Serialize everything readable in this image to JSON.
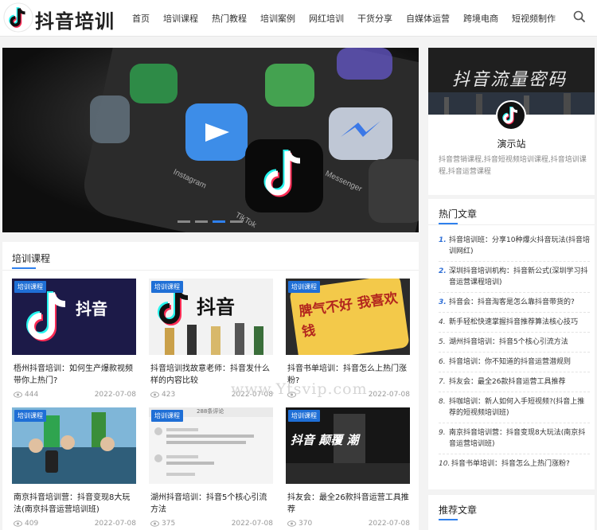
{
  "header": {
    "logo_text": "抖音培训",
    "nav": [
      "首页",
      "培训课程",
      "热门教程",
      "培训案例",
      "网红培训",
      "干货分享",
      "自媒体运营",
      "跨境电商",
      "短视频制作"
    ]
  },
  "slider": {
    "app_labels": [
      "Instagram",
      "Messenger",
      "TikTok"
    ],
    "active_dot": 3,
    "dot_count": 4
  },
  "courses": {
    "title": "培训课程",
    "items": [
      {
        "tag": "培训课程",
        "title": "梧州抖音培训：如何生产爆款视频带你上热门?",
        "views": "444",
        "date": "2022-07-08",
        "thumb_text": "抖音"
      },
      {
        "tag": "培训课程",
        "title": "抖音培训找故意老师：抖音发什么样的内容比较",
        "views": "423",
        "date": "2022-07-08",
        "thumb_text": "抖音"
      },
      {
        "tag": "培训课程",
        "title": "抖音书单培训：抖音怎么上热门涨粉?",
        "views": "",
        "date": "2022-07-08",
        "thumb_text": "脾气不好 我喜欢钱"
      },
      {
        "tag": "培训课程",
        "title": "南京抖音培训营：抖音变现8大玩法(南京抖音运营培训班)",
        "views": "409",
        "date": "2022-07-08",
        "thumb_text": ""
      },
      {
        "tag": "培训课程",
        "title": "湖州抖音培训：抖音5个核心引流方法",
        "views": "375",
        "date": "2022-07-08",
        "thumb_text": "288条评论"
      },
      {
        "tag": "培训课程",
        "title": "抖友会：最全26款抖音运营工具推荐",
        "views": "370",
        "date": "2022-07-08",
        "thumb_text": "抖音 颠覆 潮"
      }
    ]
  },
  "watermark": "www.Ytsvip.com",
  "profile": {
    "banner_text": "抖音流量密码",
    "name": "演示站",
    "desc": "抖音营销课程,抖音短视频培训课程,抖音培训课程,抖音运营课程"
  },
  "hot": {
    "title": "热门文章",
    "items": [
      {
        "num": "1.",
        "text": "抖音培训班：分享10种爆火抖音玩法(抖音培训网红)"
      },
      {
        "num": "2.",
        "text": "深圳抖音培训机构：抖音新公式(深圳学习抖音运营课程培训)"
      },
      {
        "num": "3.",
        "text": "抖音会：抖音淘客是怎么靠抖音带货的?"
      },
      {
        "num": "4.",
        "text": "新手轻松快速掌握抖音推荐算法核心技巧"
      },
      {
        "num": "5.",
        "text": "湖州抖音培训：抖音5个核心引流方法"
      },
      {
        "num": "6.",
        "text": "抖音培训：你不知道的抖音运营潜规则"
      },
      {
        "num": "7.",
        "text": "抖友会：最全26款抖音运营工具推荐"
      },
      {
        "num": "8.",
        "text": "抖咖培训：新人如何入手短视频?(抖音上推荐的短视频培训班)"
      },
      {
        "num": "9.",
        "text": "南京抖音培训营：抖音变现8大玩法(南京抖音运营培训班)"
      },
      {
        "num": "10.",
        "text": "抖音书单培训：抖音怎么上热门涨粉?"
      }
    ]
  },
  "recommend": {
    "title": "推荐文章"
  },
  "colors": {
    "accent": "#2f80ed",
    "tag_bg": "#1f6fd6"
  }
}
